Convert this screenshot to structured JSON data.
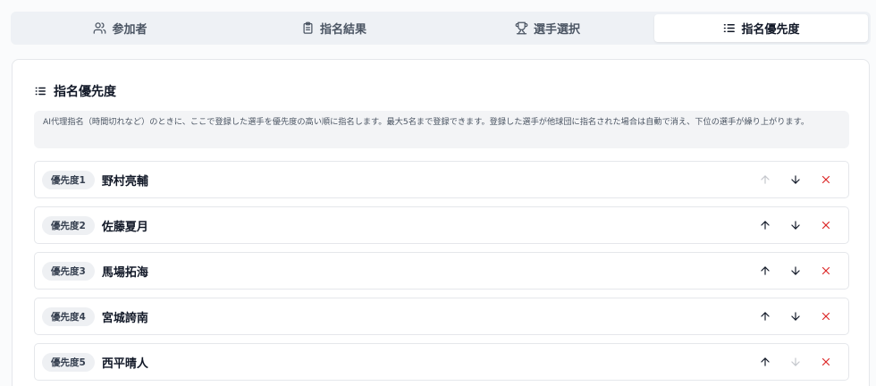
{
  "tabs": [
    {
      "label": "参加者",
      "icon": "users-icon",
      "active": false
    },
    {
      "label": "指名結果",
      "icon": "clipboard-icon",
      "active": false
    },
    {
      "label": "選手選択",
      "icon": "trophy-icon",
      "active": false
    },
    {
      "label": "指名優先度",
      "icon": "list-ordered-icon",
      "active": true
    }
  ],
  "card": {
    "title": "指名優先度",
    "title_icon": "list-ordered-icon",
    "info": "AI代理指名（時間切れなど）のときに、ここで登録した選手を優先度の高い順に指名します。最大5名まで登録できます。登録した選手が他球団に指名された場合は自動で消え、下位の選手が繰り上がります。"
  },
  "priority_list": [
    {
      "badge": "優先度1",
      "name": "野村亮輔",
      "up_enabled": false,
      "down_enabled": true
    },
    {
      "badge": "優先度2",
      "name": "佐藤夏月",
      "up_enabled": true,
      "down_enabled": true
    },
    {
      "badge": "優先度3",
      "name": "馬場拓海",
      "up_enabled": true,
      "down_enabled": true
    },
    {
      "badge": "優先度4",
      "name": "宮城誇南",
      "up_enabled": true,
      "down_enabled": true
    },
    {
      "badge": "優先度5",
      "name": "西平晴人",
      "up_enabled": true,
      "down_enabled": false
    }
  ],
  "colors": {
    "accent_text": "#111827",
    "remove": "#dc2626",
    "muted": "#9ca3af"
  }
}
